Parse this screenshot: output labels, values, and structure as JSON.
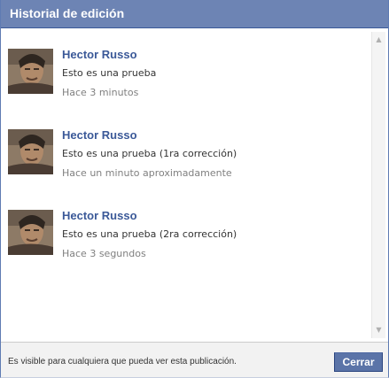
{
  "dialog": {
    "title": "Historial de edición"
  },
  "history": [
    {
      "author": "Hector Russo",
      "text": "Esto es una prueba",
      "time": "Hace 3 minutos"
    },
    {
      "author": "Hector Russo",
      "text": "Esto es una prueba (1ra corrección)",
      "time": "Hace un minuto aproximadamente"
    },
    {
      "author": "Hector Russo",
      "text": "Esto es una prueba (2ra corrección)",
      "time": "Hace 3 segundos"
    }
  ],
  "scrollbar": {
    "up_icon": "scroll-up-arrow",
    "down_icon": "scroll-down-arrow"
  },
  "footer": {
    "visibility_text": "Es visible para cualquiera que pueda ver esta publicación.",
    "close_label": "Cerrar"
  },
  "colors": {
    "titlebar": "#6d84b4",
    "name_link": "#3b5998",
    "button": "#5b74a8"
  }
}
